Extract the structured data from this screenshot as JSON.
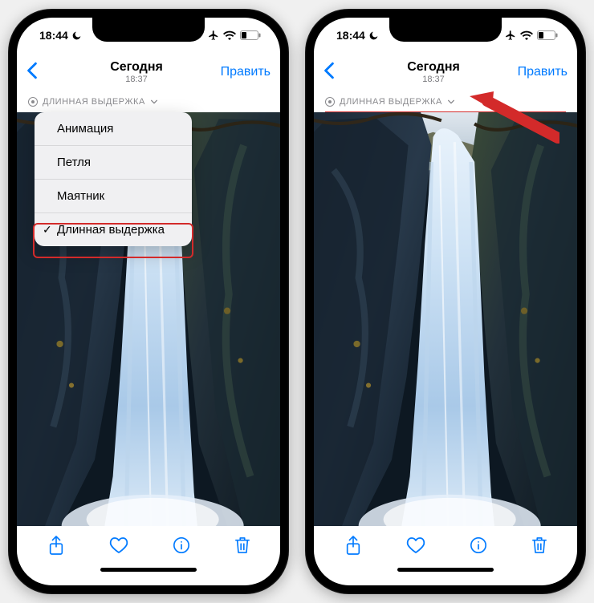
{
  "status": {
    "time": "18:44"
  },
  "nav": {
    "title": "Сегодня",
    "subtitle": "18:37",
    "edit": "Править"
  },
  "effect": {
    "label": "ДЛИННАЯ ВЫДЕРЖКА"
  },
  "dropdown": {
    "items": [
      {
        "label": "Анимация"
      },
      {
        "label": "Петля"
      },
      {
        "label": "Маятник"
      },
      {
        "label": "Длинная выдержка"
      }
    ],
    "selected_index": 3
  },
  "colors": {
    "accent": "#007aff",
    "highlight": "#d32a2a"
  }
}
